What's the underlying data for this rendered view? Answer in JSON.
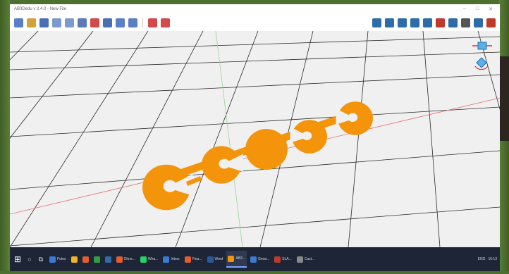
{
  "window": {
    "title": "AB3Dedu v 2.4.0 - New File",
    "controls": {
      "minimize": "–",
      "maximize": "□",
      "close": "✕"
    }
  },
  "toolbar": {
    "left_icons": [
      {
        "name": "new-file-icon",
        "color": "#5b7fc4"
      },
      {
        "name": "open-folder-icon",
        "color": "#d4a23a"
      },
      {
        "name": "save-icon",
        "color": "#4a6fb5"
      },
      {
        "name": "undo-icon",
        "color": "#7b9bd0"
      },
      {
        "name": "redo-icon",
        "color": "#7b9bd0"
      },
      {
        "name": "tools-icon",
        "color": "#5a7ab8"
      },
      {
        "name": "delete-icon",
        "color": "#d24a4a"
      },
      {
        "name": "group-icon",
        "color": "#4a6fb5"
      },
      {
        "name": "copy-icon",
        "color": "#5b7fc4"
      },
      {
        "name": "measure-icon",
        "color": "#5b7fc4"
      },
      {
        "name": "layers-icon",
        "color": "#d24a4a"
      },
      {
        "name": "view-icon",
        "color": "#d24a4a"
      }
    ],
    "right_icons": [
      {
        "name": "user-icon",
        "color": "#2d6ca8"
      },
      {
        "name": "share-icon",
        "color": "#2d6ca8"
      },
      {
        "name": "print-icon",
        "color": "#2d6ca8"
      },
      {
        "name": "slice-icon",
        "color": "#2d6ca8"
      },
      {
        "name": "fullscreen-icon",
        "color": "#2d6ca8"
      },
      {
        "name": "shield-icon",
        "color": "#c0392b"
      },
      {
        "name": "material-icon",
        "color": "#2d6ca8"
      },
      {
        "name": "settings-icon",
        "color": "#555"
      },
      {
        "name": "grid-icon",
        "color": "#2d6ca8"
      },
      {
        "name": "cube-icon",
        "color": "#c0392b"
      }
    ]
  },
  "scene": {
    "background": "#f0f0f0",
    "grid_color": "#2a2a2a",
    "x_axis_color": "#e07070",
    "y_axis_color": "#9ad29a",
    "object_color": "#f4940a"
  },
  "taskbar": {
    "apps": [
      {
        "label": "Fotos",
        "color": "#3a7bd5"
      },
      {
        "label": "",
        "color": "#f0b429"
      },
      {
        "label": "",
        "color": "#e65c2c"
      },
      {
        "label": "",
        "color": "#2f9e44"
      },
      {
        "label": "",
        "color": "#2d6ca8"
      },
      {
        "label": "Ohne...",
        "color": "#e65c2c"
      },
      {
        "label": "Wha...",
        "color": "#25d366"
      },
      {
        "label": "Inbox",
        "color": "#3a7bd5"
      },
      {
        "label": "Fina...",
        "color": "#e65c2c"
      },
      {
        "label": "Word",
        "color": "#2b579a"
      },
      {
        "label": "AB3...",
        "color": "#f4940a",
        "active": true
      },
      {
        "label": "Gmai...",
        "color": "#3a7bd5"
      },
      {
        "label": "SLA...",
        "color": "#c0392b"
      },
      {
        "label": "Cast...",
        "color": "#8a8a8a"
      }
    ],
    "tray": {
      "lang": "ENG",
      "time": "16:13"
    }
  }
}
